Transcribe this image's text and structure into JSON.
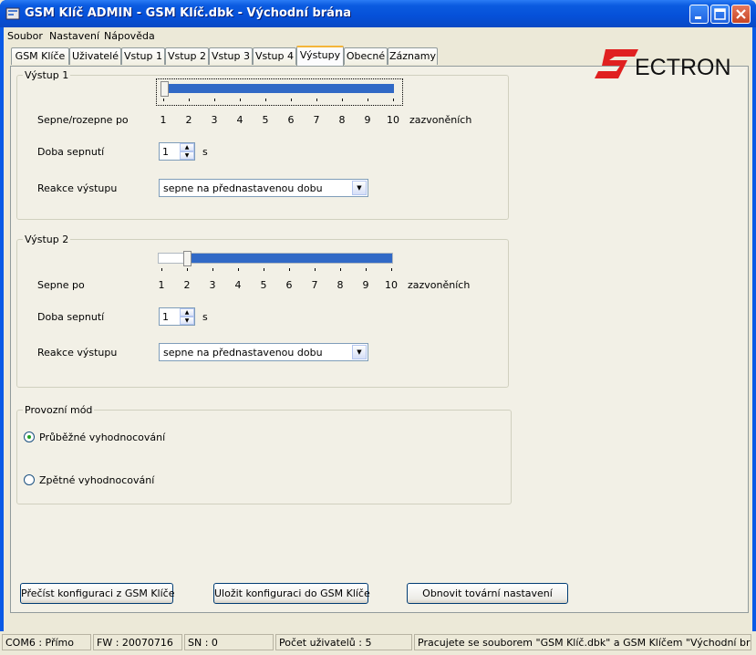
{
  "window": {
    "title": "GSM Klíč ADMIN - GSM Klíč.dbk - Východní brána"
  },
  "menu": [
    "Soubor",
    "Nastavení",
    "Nápověda"
  ],
  "tabs": [
    "GSM Klíče",
    "Uživatelé",
    "Vstup 1",
    "Vstup 2",
    "Vstup 3",
    "Vstup 4",
    "Výstupy",
    "Obecné",
    "Záznamy"
  ],
  "active_tab": "Výstupy",
  "logo": {
    "text": "ECTRON",
    "brand": "SECTRON",
    "color": "#e02020"
  },
  "output1": {
    "group_label": "Výstup 1",
    "trigger_label": "Sepne/rozepne po",
    "range_values": {
      "from": 1,
      "to": 10
    },
    "tick_labels": [
      "1",
      "2",
      "3",
      "4",
      "5",
      "6",
      "7",
      "8",
      "9",
      "10"
    ],
    "unit_label": "zazvoněních",
    "duration_label": "Doba sepnutí",
    "duration_value": "1",
    "duration_unit": "s",
    "reaction_label": "Reakce výstupu",
    "reaction_value": "sepne na přednastavenou dobu"
  },
  "output2": {
    "group_label": "Výstup 2",
    "trigger_label": "Sepne po",
    "range_values": {
      "from": 2,
      "to": 10
    },
    "tick_labels": [
      "1",
      "2",
      "3",
      "4",
      "5",
      "6",
      "7",
      "8",
      "9",
      "10"
    ],
    "unit_label": "zazvoněních",
    "duration_label": "Doba sepnutí",
    "duration_value": "1",
    "duration_unit": "s",
    "reaction_label": "Reakce výstupu",
    "reaction_value": "sepne na přednastavenou dobu"
  },
  "mode": {
    "group_label": "Provozní mód",
    "options": [
      "Průběžné vyhodnocování",
      "Zpětné vyhodnocování"
    ],
    "selected": "Průběžné vyhodnocování"
  },
  "buttons": {
    "read": "Přečíst konfiguraci z GSM Klíče",
    "save": "Uložit konfiguraci do GSM Klíče",
    "reset": "Obnovit tovární nastavení"
  },
  "status": {
    "port": "COM6 : Přímo",
    "fw": "FW : 20070716",
    "sn": "SN : 0",
    "users": "Počet uživatelů : 5",
    "message": "Pracujete se souborem \"GSM Klíč.dbk\" a GSM Klíčem \"Východní brána\""
  },
  "colors": {
    "accent": "#3169c6",
    "titlebar": "#0550d8",
    "selected_tab_highlight": "#f4b53a"
  }
}
